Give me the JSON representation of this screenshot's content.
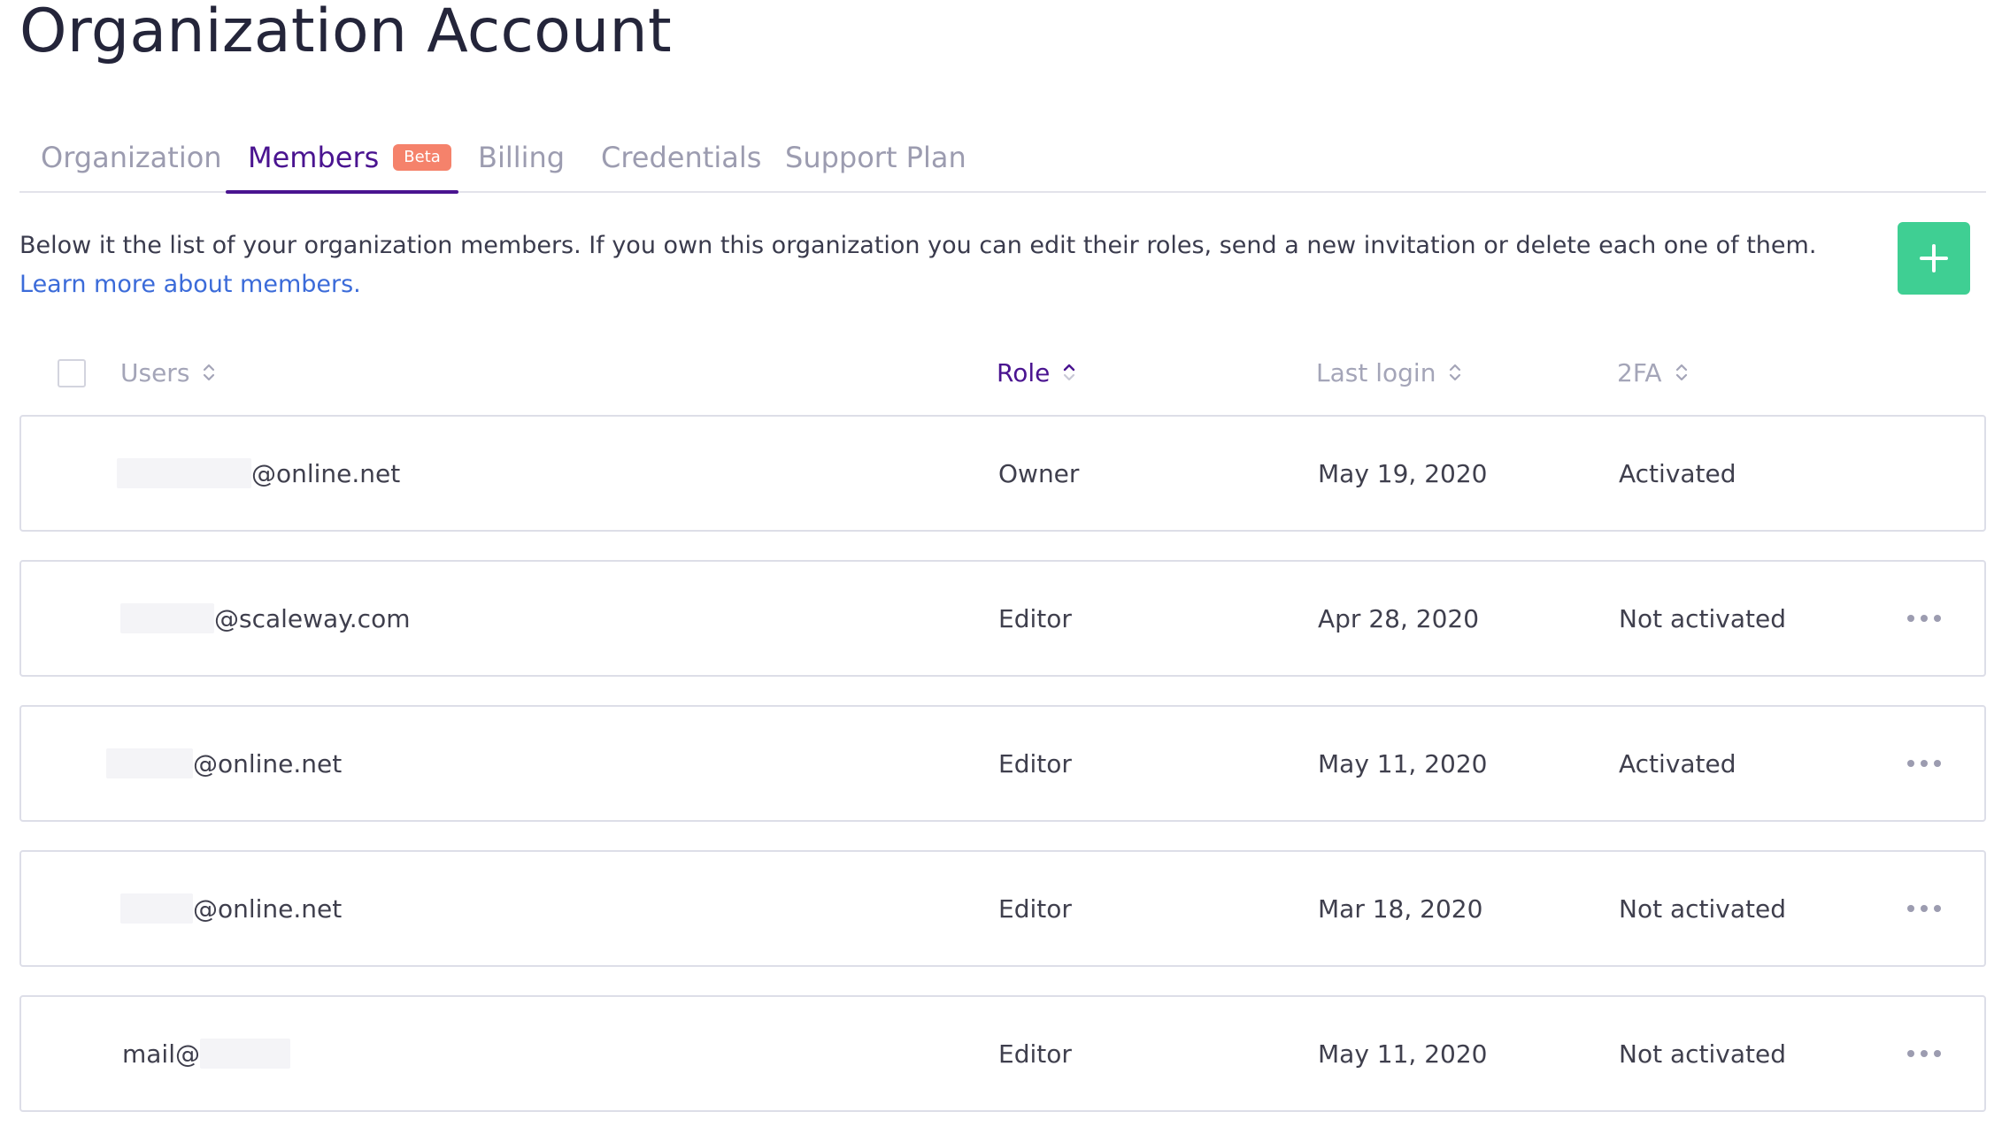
{
  "page": {
    "title": "Organization Account"
  },
  "tabs": [
    {
      "label": "Organization",
      "active": false
    },
    {
      "label": "Members",
      "active": true,
      "badge": "Beta"
    },
    {
      "label": "Billing",
      "active": false
    },
    {
      "label": "Credentials",
      "active": false
    },
    {
      "label": "Support Plan",
      "active": false
    }
  ],
  "description": {
    "text": "Below it the list of your organization members. If you own this organization you can edit their roles, send a new invitation or delete each one of them.",
    "link": "Learn more about members."
  },
  "add_button": {
    "icon": "plus-icon"
  },
  "table": {
    "columns": [
      {
        "label": "Users",
        "sort": "unsorted"
      },
      {
        "label": "Role",
        "sort": "ascending",
        "active": true
      },
      {
        "label": "Last login",
        "sort": "unsorted"
      },
      {
        "label": "2FA",
        "sort": "unsorted"
      }
    ],
    "rows": [
      {
        "user_visible": "@online.net",
        "role": "Owner",
        "last_login": "May 19, 2020",
        "twofa": "Activated",
        "has_menu": false
      },
      {
        "user_visible": "@scaleway.com",
        "role": "Editor",
        "last_login": "Apr 28, 2020",
        "twofa": "Not activated",
        "has_menu": true
      },
      {
        "user_visible": "@online.net",
        "role": "Editor",
        "last_login": "May 11, 2020",
        "twofa": "Activated",
        "has_menu": true
      },
      {
        "user_visible": "@online.net",
        "role": "Editor",
        "last_login": "Mar 18, 2020",
        "twofa": "Not activated",
        "has_menu": true
      },
      {
        "user_visible": "mail@",
        "role": "Editor",
        "last_login": "May 11, 2020",
        "twofa": "Not activated",
        "has_menu": true
      }
    ]
  },
  "colors": {
    "accent": "#4a1490",
    "add_button": "#3fcf93",
    "badge": "#f5826b",
    "link": "#3b6bd9"
  }
}
